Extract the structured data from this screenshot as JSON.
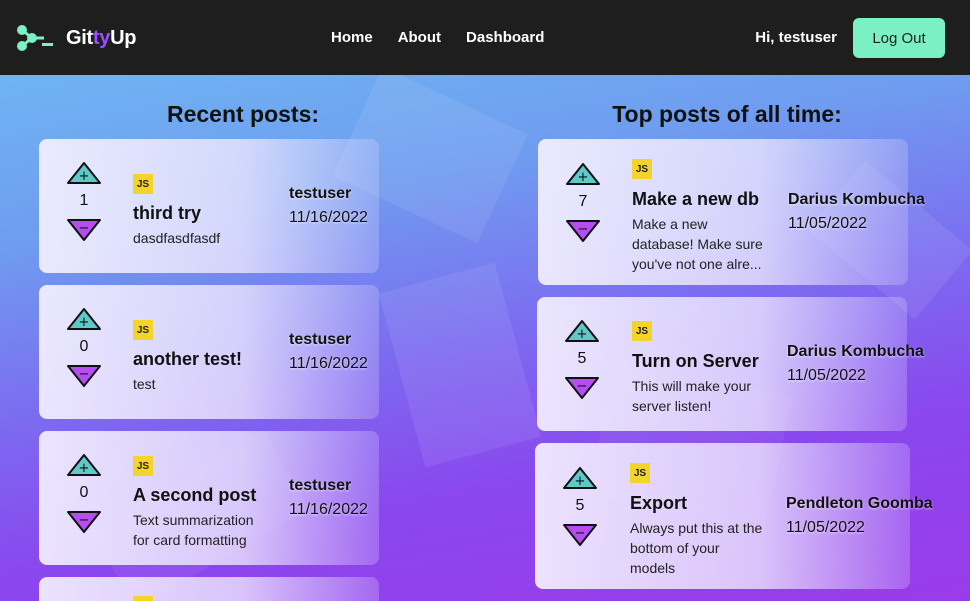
{
  "app": {
    "brand_prefix": "Git",
    "brand_accent": "ty",
    "brand_suffix": "Up"
  },
  "nav": {
    "links": [
      "Home",
      "About",
      "Dashboard"
    ],
    "greeting": "Hi, testuser",
    "logout_label": "Log Out"
  },
  "colors": {
    "brand_green": "#7af0c4",
    "arrow_up": "#5fc8c8",
    "arrow_down": "#b54ef0",
    "js_badge": "#f3d42a"
  },
  "recent": {
    "title": "Recent posts:",
    "posts": [
      {
        "score": "1",
        "badge": "JS",
        "title": "third try",
        "body": "dasdfasdfasdf",
        "author": "testuser",
        "date": "11/16/2022"
      },
      {
        "score": "0",
        "badge": "JS",
        "title": "another test!",
        "body": "test",
        "author": "testuser",
        "date": "11/16/2022"
      },
      {
        "score": "0",
        "badge": "JS",
        "title": "A second post",
        "body": "Text summarization for card formatting",
        "author": "testuser",
        "date": "11/16/2022"
      },
      {
        "badge": "JS"
      }
    ]
  },
  "top": {
    "title": "Top posts of all time:",
    "posts": [
      {
        "score": "7",
        "badge": "JS",
        "title": "Make a new db",
        "body": "Make a new database! Make sure you've not one alre...",
        "author": "Darius Kombucha",
        "date": "11/05/2022"
      },
      {
        "score": "5",
        "badge": "JS",
        "title": "Turn on Server",
        "body": "This will make your server listen!",
        "author": "Darius Kombucha",
        "date": "11/05/2022"
      },
      {
        "score": "5",
        "badge": "JS",
        "title": "Export",
        "body": "Always put this at the bottom of your models",
        "author": "Pendleton Goomba",
        "date": "11/05/2022"
      }
    ]
  }
}
